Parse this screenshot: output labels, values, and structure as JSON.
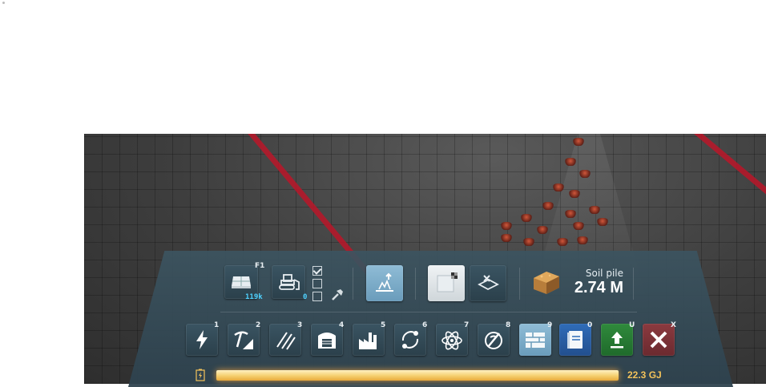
{
  "top_row": {
    "foundation": {
      "hotkey": "F1",
      "count": "119k",
      "icon": "foundation-icon"
    },
    "bulldozer": {
      "count": "0",
      "icon": "bulldozer-icon"
    },
    "options": {
      "checkbox_states": [
        true,
        false,
        false
      ],
      "icon": "hammer-icon"
    },
    "terrain_tools": {
      "icon": "surface-raise-icon"
    },
    "surface": {
      "icon": "surface-tile-icon"
    },
    "remove_surface": {
      "icon": "remove-surface-icon"
    },
    "resource": {
      "label": "Soil pile",
      "value": "2.74 M",
      "icon": "soil-pile-icon"
    }
  },
  "bottom_row": {
    "categories": [
      {
        "hotkey": "1",
        "icon": "power-icon"
      },
      {
        "hotkey": "2",
        "icon": "mining-icon"
      },
      {
        "hotkey": "3",
        "icon": "transport-icon"
      },
      {
        "hotkey": "4",
        "icon": "storage-icon"
      },
      {
        "hotkey": "5",
        "icon": "factory-icon"
      },
      {
        "hotkey": "6",
        "icon": "logistics-cycle-icon"
      },
      {
        "hotkey": "7",
        "icon": "science-atom-icon"
      },
      {
        "hotkey": "8",
        "icon": "vehicles-icon"
      },
      {
        "hotkey": "9",
        "icon": "buildings-wall-icon"
      },
      {
        "hotkey": "0",
        "icon": "blueprint-book-icon"
      },
      {
        "hotkey": "U",
        "icon": "upgrade-icon"
      },
      {
        "hotkey": "X",
        "icon": "cancel-icon"
      }
    ]
  },
  "energy": {
    "value": "22.3 GJ",
    "level": 1.0,
    "icon": "battery-icon"
  },
  "colors": {
    "accent": "#4fd2ff",
    "energy": "#f4c35a",
    "panel": "#3a5462",
    "marking": "#b4182a"
  }
}
